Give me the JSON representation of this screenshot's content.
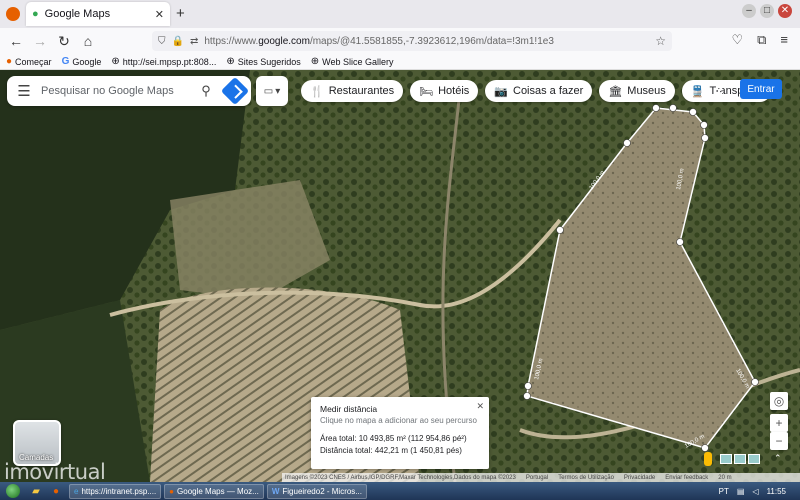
{
  "browser": {
    "tab_title": "Google Maps",
    "tab_close": "✕",
    "new_tab": "+",
    "back": "←",
    "forward": "→",
    "reload": "↻",
    "home": "⌂",
    "url_prefix": "https://www.",
    "url_domain": "google.com",
    "url_rest": "/maps/@41.5581855,-7.3923612,196m/data=!3m1!1e3",
    "bookmarks": [
      {
        "icon": "firefox-icon",
        "label": "Começar"
      },
      {
        "icon": "google-icon",
        "label": "Google"
      },
      {
        "icon": "globe-icon",
        "label": "http://sei.mpsp.pt:808..."
      },
      {
        "icon": "globe-icon",
        "label": "Sites Sugeridos"
      },
      {
        "icon": "globe-icon",
        "label": "Web Slice Gallery"
      }
    ]
  },
  "maps": {
    "search_placeholder": "Pesquisar no Google Maps",
    "chips": [
      {
        "icon": "restaurant-icon",
        "glyph": "🍴",
        "label": "Restaurantes"
      },
      {
        "icon": "hotel-icon",
        "glyph": "🛏",
        "label": "Hotéis"
      },
      {
        "icon": "camera-icon",
        "glyph": "📷",
        "label": "Coisas a fazer"
      },
      {
        "icon": "museum-icon",
        "glyph": "🏛",
        "label": "Museus"
      },
      {
        "icon": "transit-icon",
        "glyph": "🚆",
        "label": "Transpo"
      }
    ],
    "signin_label": "Entrar",
    "layers_label": "Camadas",
    "measure": {
      "title": "Medir distância",
      "hint": "Clique no mapa a adicionar ao seu percurso",
      "area": "Área total: 10 493,85 m² (112 954,86 pé²)",
      "distance": "Distância total: 442,21 m (1 450,81 pés)"
    },
    "segment_labels": [
      "100,0 m",
      "100,0 m",
      "100,0 m",
      "100,0 m",
      "100,0 m"
    ],
    "attribution": [
      "Imagens ©2023 CNES / Airbus,IGP/DGRF,Maxar Technologies,Dados do mapa ©2023",
      "Portugal",
      "Termos de Utilização",
      "Privacidade",
      "Enviar feedback",
      "20 m"
    ],
    "watermark": "imovirtual",
    "colors": {
      "accent": "#1a73e8",
      "measure_line": "#ffffff"
    }
  },
  "taskbar": {
    "tasks": [
      {
        "icon": "ie-icon",
        "label": "https://intranet.psp...."
      },
      {
        "icon": "firefox-icon",
        "label": "Google Maps — Moz..."
      },
      {
        "icon": "word-icon",
        "label": "Figueiredo2 - Micros..."
      }
    ],
    "language": "PT",
    "clock": "11:55"
  }
}
